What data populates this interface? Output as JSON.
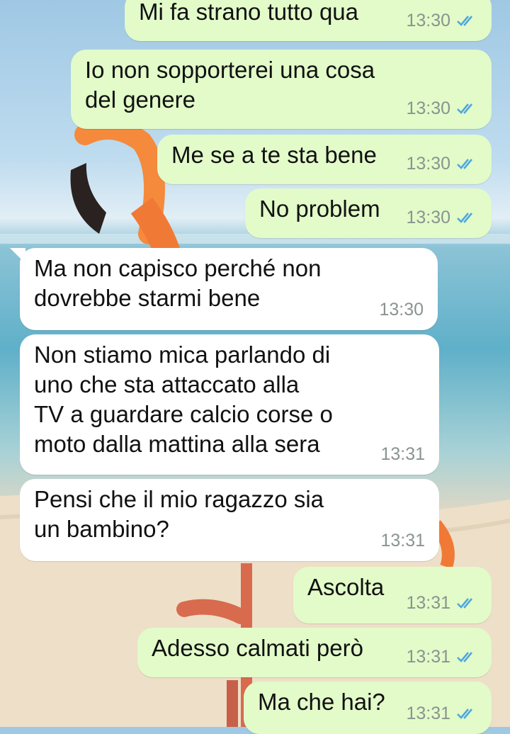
{
  "colors": {
    "outgoing_bubble": "#e2fbc9",
    "incoming_bubble": "#ffffff",
    "read_ticks": "#4fa7e0",
    "timestamp": "#8a948f"
  },
  "messages": [
    {
      "dir": "out",
      "text": "Mi fa strano tutto qua",
      "time": "13:30",
      "status_icon": "double-check-read-icon"
    },
    {
      "dir": "out",
      "text": "Io non sopporterei una cosa del genere",
      "time": "13:30",
      "status_icon": "double-check-read-icon"
    },
    {
      "dir": "out",
      "text": "Me se a te sta bene",
      "time": "13:30",
      "status_icon": "double-check-read-icon"
    },
    {
      "dir": "out",
      "text": "No problem",
      "time": "13:30",
      "status_icon": "double-check-read-icon"
    },
    {
      "dir": "in",
      "text": "Ma non capisco perché non dovrebbe starmi bene",
      "time": "13:30"
    },
    {
      "dir": "in",
      "text": "Non stiamo mica parlando di uno che sta attaccato alla TV a guardare calcio corse o moto dalla mattina alla sera",
      "time": "13:31"
    },
    {
      "dir": "in",
      "text": "Pensi che il mio ragazzo sia un bambino?",
      "time": "13:31"
    },
    {
      "dir": "out",
      "text": "Ascolta",
      "time": "13:31",
      "status_icon": "double-check-read-icon"
    },
    {
      "dir": "out",
      "text": "Adesso calmati però",
      "time": "13:31",
      "status_icon": "double-check-read-icon"
    },
    {
      "dir": "out",
      "text": "Ma che hai?",
      "time": "13:31",
      "status_icon": "double-check-read-icon"
    }
  ]
}
